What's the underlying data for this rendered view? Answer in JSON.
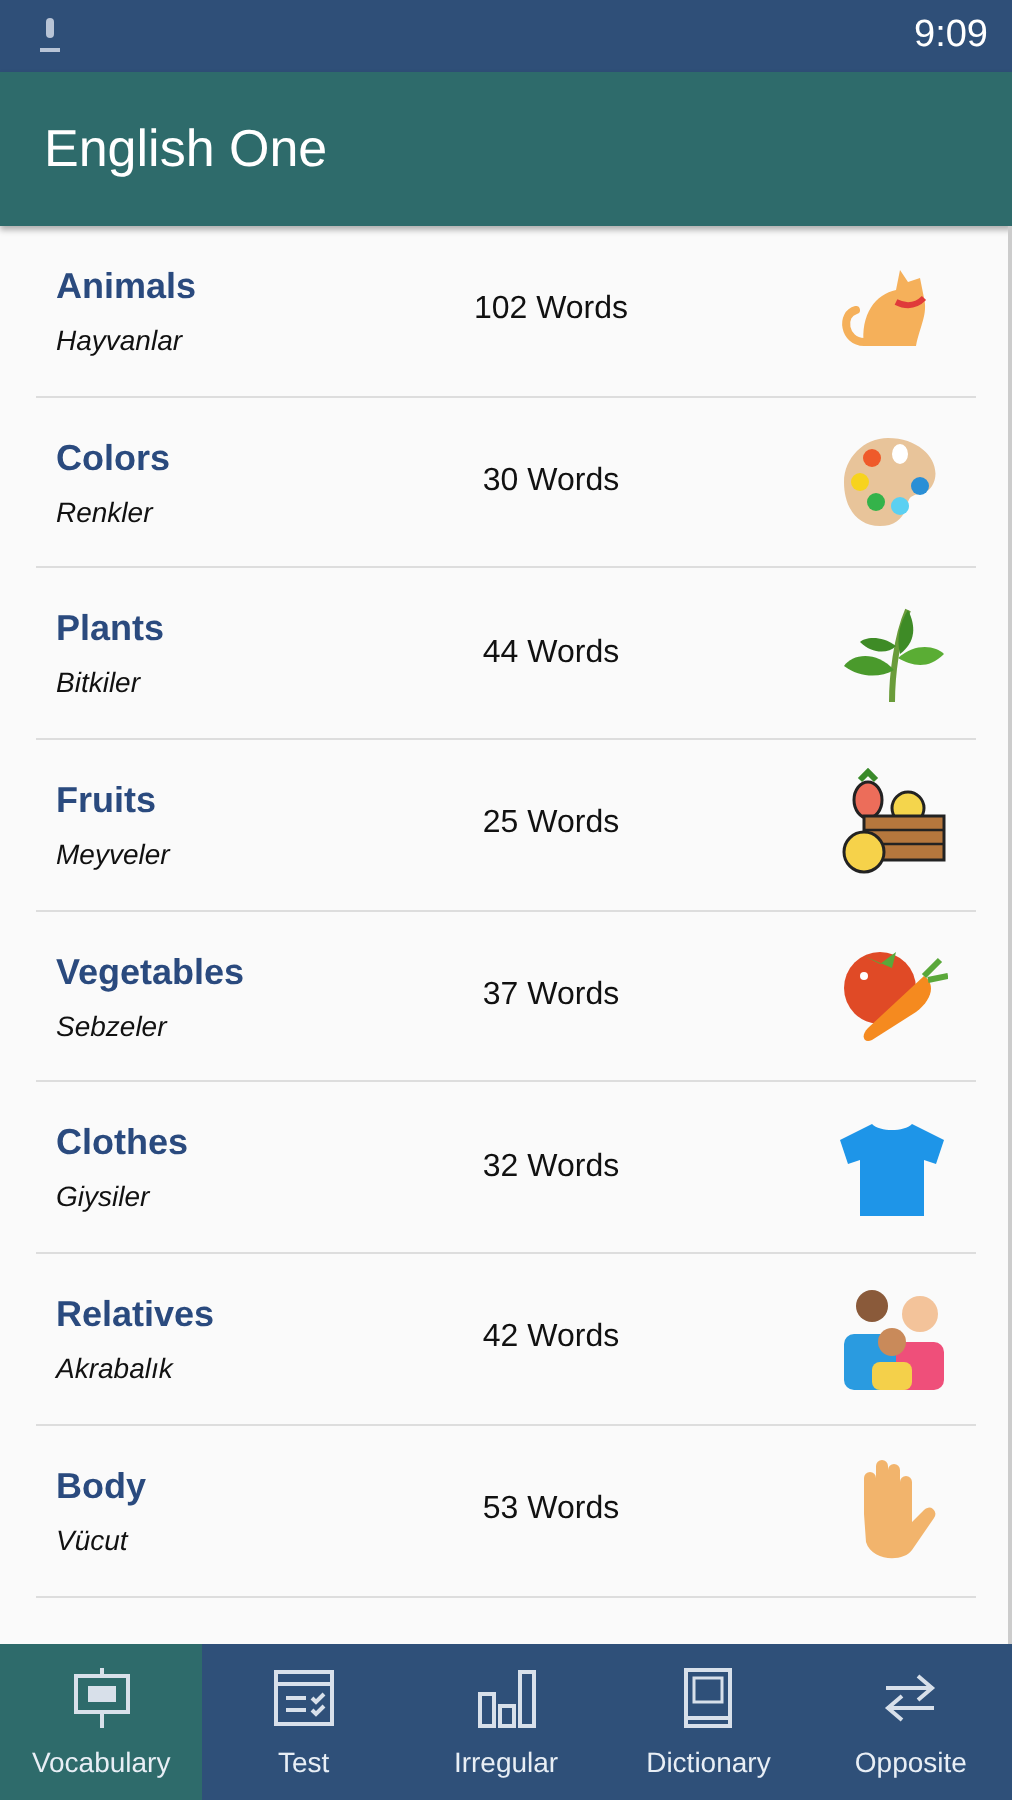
{
  "status_bar": {
    "time": "9:09"
  },
  "app_bar": {
    "title": "English One"
  },
  "categories": [
    {
      "title": "Animals",
      "subtitle": "Hayvanlar",
      "count": "102 Words"
    },
    {
      "title": "Colors",
      "subtitle": "Renkler",
      "count": "30 Words"
    },
    {
      "title": "Plants",
      "subtitle": "Bitkiler",
      "count": "44 Words"
    },
    {
      "title": "Fruits",
      "subtitle": "Meyveler",
      "count": "25 Words"
    },
    {
      "title": "Vegetables",
      "subtitle": "Sebzeler",
      "count": "37 Words"
    },
    {
      "title": "Clothes",
      "subtitle": "Giysiler",
      "count": "32 Words"
    },
    {
      "title": "Relatives",
      "subtitle": "Akrabalık",
      "count": "42 Words"
    },
    {
      "title": "Body",
      "subtitle": "Vücut",
      "count": "53 Words"
    }
  ],
  "bottom_nav": [
    {
      "label": "Vocabulary",
      "selected": true
    },
    {
      "label": "Test",
      "selected": false
    },
    {
      "label": "Irregular",
      "selected": false
    },
    {
      "label": "Dictionary",
      "selected": false
    },
    {
      "label": "Opposite",
      "selected": false
    }
  ]
}
